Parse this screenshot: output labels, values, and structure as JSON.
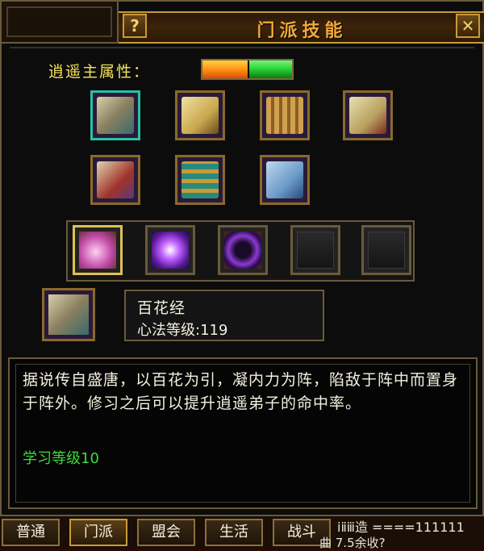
{
  "window": {
    "title": "门派技能",
    "help_label": "?",
    "close_label": "✕"
  },
  "attribute": {
    "label": "逍遥主属性：",
    "fire_color": "#ff8a1a",
    "green_color": "#2bd63a"
  },
  "books": [
    {
      "icon": "scroll-stack-icon"
    },
    {
      "icon": "open-book-icon"
    },
    {
      "icon": "bamboo-scroll-icon"
    },
    {
      "icon": "hanging-scroll-icon"
    },
    {
      "icon": "red-scroll-icon"
    },
    {
      "icon": "book-bundle-icon"
    },
    {
      "icon": "blue-scroll-icon"
    }
  ],
  "skills": [
    {
      "icon": "petal-icon"
    },
    {
      "icon": "purple-burst-icon"
    },
    {
      "icon": "dark-orb-icon"
    },
    {
      "icon": "empty-slot-icon"
    },
    {
      "icon": "empty-slot-icon"
    }
  ],
  "selected": {
    "name": "百花经",
    "level": "心法等级:119"
  },
  "description": {
    "text": "据说传自盛唐，以百花为引，凝内力为阵，陷敌于阵中而置身于阵外。修习之后可以提升逍遥弟子的命中率。",
    "level_requirement": "学习等级10"
  },
  "tabs": [
    "普通",
    "门派",
    "盟会",
    "生活",
    "战斗"
  ],
  "chat": {
    "line1": "ⅰⅱⅲ造 ====111111",
    "line2": "曲 7.5余收?"
  }
}
